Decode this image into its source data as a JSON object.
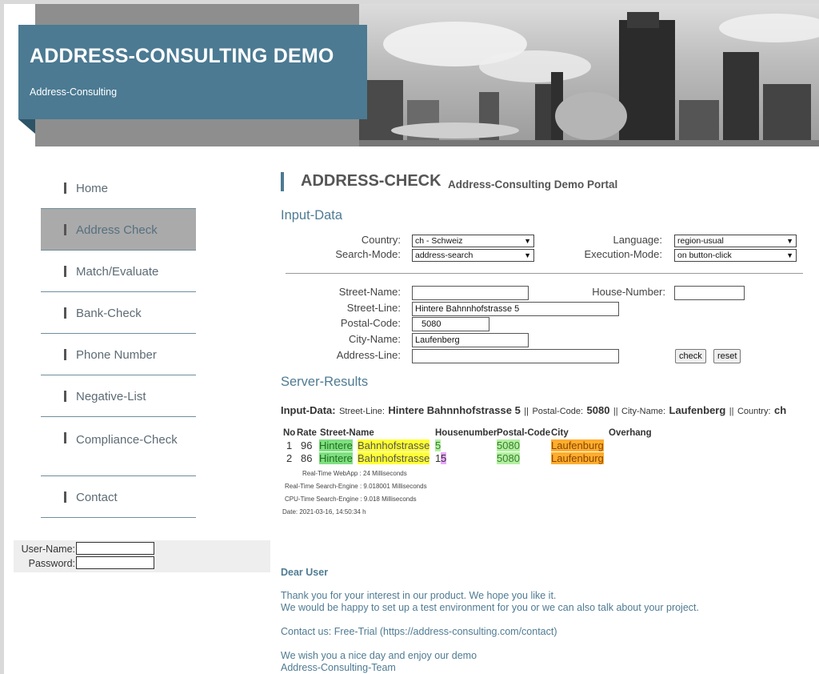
{
  "header": {
    "title": "ADDRESS-CONSULTING DEMO",
    "subtitle": "Address-Consulting"
  },
  "sidebar": {
    "items": [
      {
        "label": "Home"
      },
      {
        "label": "Address Check"
      },
      {
        "label": "Match/Evaluate"
      },
      {
        "label": "Bank-Check"
      },
      {
        "label": "Phone Number"
      },
      {
        "label": "Negative-List"
      },
      {
        "label": "Compliance-Check"
      },
      {
        "label": "Contact"
      }
    ]
  },
  "login": {
    "username_label": "User-Name:",
    "password_label": "Password:",
    "username_value": "",
    "password_value": ""
  },
  "main": {
    "heading": "ADDRESS-CHECK",
    "heading_sub": "Address-Consulting Demo Portal",
    "input_section_title": "Input-Data",
    "country_label": "Country:",
    "country_value": "ch - Schweiz",
    "language_label": "Language:",
    "language_value": "region-usual",
    "search_mode_label": "Search-Mode:",
    "search_mode_value": "address-search",
    "execution_mode_label": "Execution-Mode:",
    "execution_mode_value": "on button-click",
    "street_name_label": "Street-Name:",
    "street_name_value": "",
    "house_number_label": "House-Number:",
    "house_number_value": "",
    "street_line_label": "Street-Line:",
    "street_line_value": "Hintere Bahnnhofstrasse 5",
    "postal_code_label": "Postal-Code:",
    "postal_code_value": "5080",
    "city_name_label": "City-Name:",
    "city_name_value": "Laufenberg",
    "address_line_label": "Address-Line:",
    "address_line_value": "",
    "check_button": "check",
    "reset_button": "reset",
    "results_section_title": "Server-Results"
  },
  "summary": {
    "prefix": "Input-Data:",
    "street_line_key": "Street-Line:",
    "street_line_val": "Hintere Bahnnhofstrasse 5",
    "sep1": "||",
    "postal_key": "Postal-Code:",
    "postal_val": "5080",
    "sep2": "||",
    "city_key": "City-Name:",
    "city_val": "Laufenberg",
    "sep3": "||",
    "country_key": "Country:",
    "country_val": "ch"
  },
  "results": {
    "columns": [
      "No",
      "Rate",
      "Street-Name",
      "Housenumber",
      "Postal-Code",
      "City",
      "Overhang"
    ],
    "rows": [
      {
        "no": "1",
        "rate": "96",
        "street_a": "Hintere",
        "street_b": "Bahnhofstrasse",
        "house_a": "5",
        "house_b": "",
        "postal": "5080",
        "city": "Laufenburg"
      },
      {
        "no": "2",
        "rate": "86",
        "street_a": "Hintere",
        "street_b": "Bahnhofstrasse",
        "house_a": "1",
        "house_b": "5",
        "postal": "5080",
        "city": "Laufenburg"
      }
    ],
    "meta": [
      "Real-Time WebApp : 24 Milliseconds",
      "Real-Time Search-Engine : 9.018001 Milliseconds",
      "CPU-Time Search-Engine : 9.018 Milliseconds",
      "Date: 2021-03-16, 14:50:34 h"
    ]
  },
  "message": {
    "title": "Dear User",
    "line1": "Thank you for your interest in our product. We hope you like it.",
    "line2": "We would be happy to set up a test environment for you or we can also talk about your project.",
    "line3": "Contact us: Free-Trial (https://address-consulting.com/contact)",
    "line4": "We wish you a nice day and enjoy our demo",
    "line5": "Address-Consulting-Team"
  },
  "colors": {
    "brand": "#4b7a92",
    "match_green": "#7fe07f",
    "match_yellow": "#ffff33",
    "match_orange": "#ffad2c",
    "match_violet": "#e8a8ff"
  }
}
